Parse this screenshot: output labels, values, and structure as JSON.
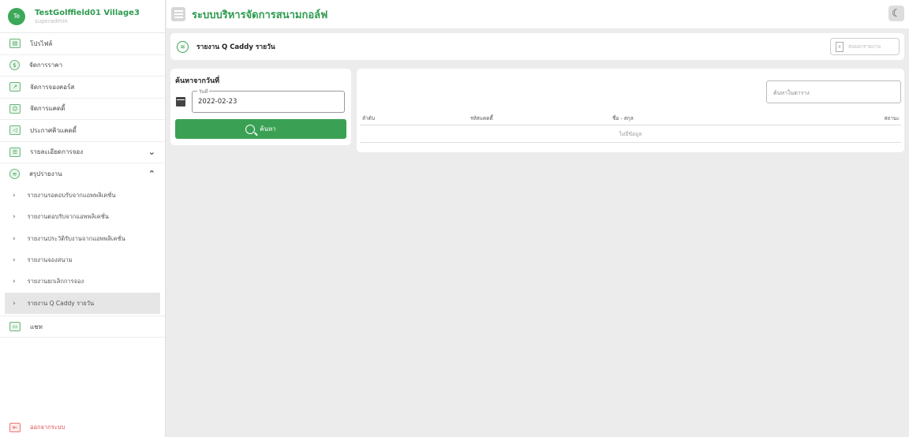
{
  "profile": {
    "initials": "Te",
    "name": "TestGolffield01 Village3",
    "role": "superadmin"
  },
  "menu": [
    {
      "label": "โปรไฟล์",
      "icon": "id-card-icon"
    },
    {
      "label": "จัดการราคา",
      "icon": "dollar-circle-icon"
    },
    {
      "label": "จัดการจองคอร์ส",
      "icon": "chart-trend-icon"
    },
    {
      "label": "จัดการแคดดี้",
      "icon": "users-icon"
    },
    {
      "label": "ประกาศคิวแคดดี้",
      "icon": "megaphone-icon"
    },
    {
      "label": "รายละเอียดการจอง",
      "icon": "list-icon",
      "expanded": false
    },
    {
      "label": "สรุปรายงาน",
      "icon": "layers-icon",
      "expanded": true
    }
  ],
  "submenu": [
    "รายงานรอตอบรับจากแอพพลิเคชั่น",
    "รายงานตอบรับจากแอพพลิเคชั่น",
    "รายงานประวัติรับงานจากแอพพลิเคชั่น",
    "รายงานจองสนาม",
    "รายงานยกเลิกการจอง",
    "รายงาน Q Caddy รายวัน"
  ],
  "chat_label": "แชท",
  "logout_label": "ออกจากระบบ",
  "header": {
    "title": "ระบบบริหารจัดการสนามกอล์ฟ"
  },
  "report": {
    "title": "รายงาน Q Caddy รายวัน",
    "export_label": "ส่งออกรายงาน"
  },
  "search": {
    "label": "ค้นหาจากวันที่",
    "date_legend": "วันที่",
    "date_value": "2022-02-23",
    "button_label": "ค้นหา"
  },
  "table": {
    "search_placeholder": "ค้นหาในตาราง",
    "columns": [
      "ลำดับ",
      "รหัสแคดดี้",
      "ชื่อ - สกุล",
      "สถานะ"
    ],
    "empty_text": "ไม่มีข้อมูล"
  }
}
